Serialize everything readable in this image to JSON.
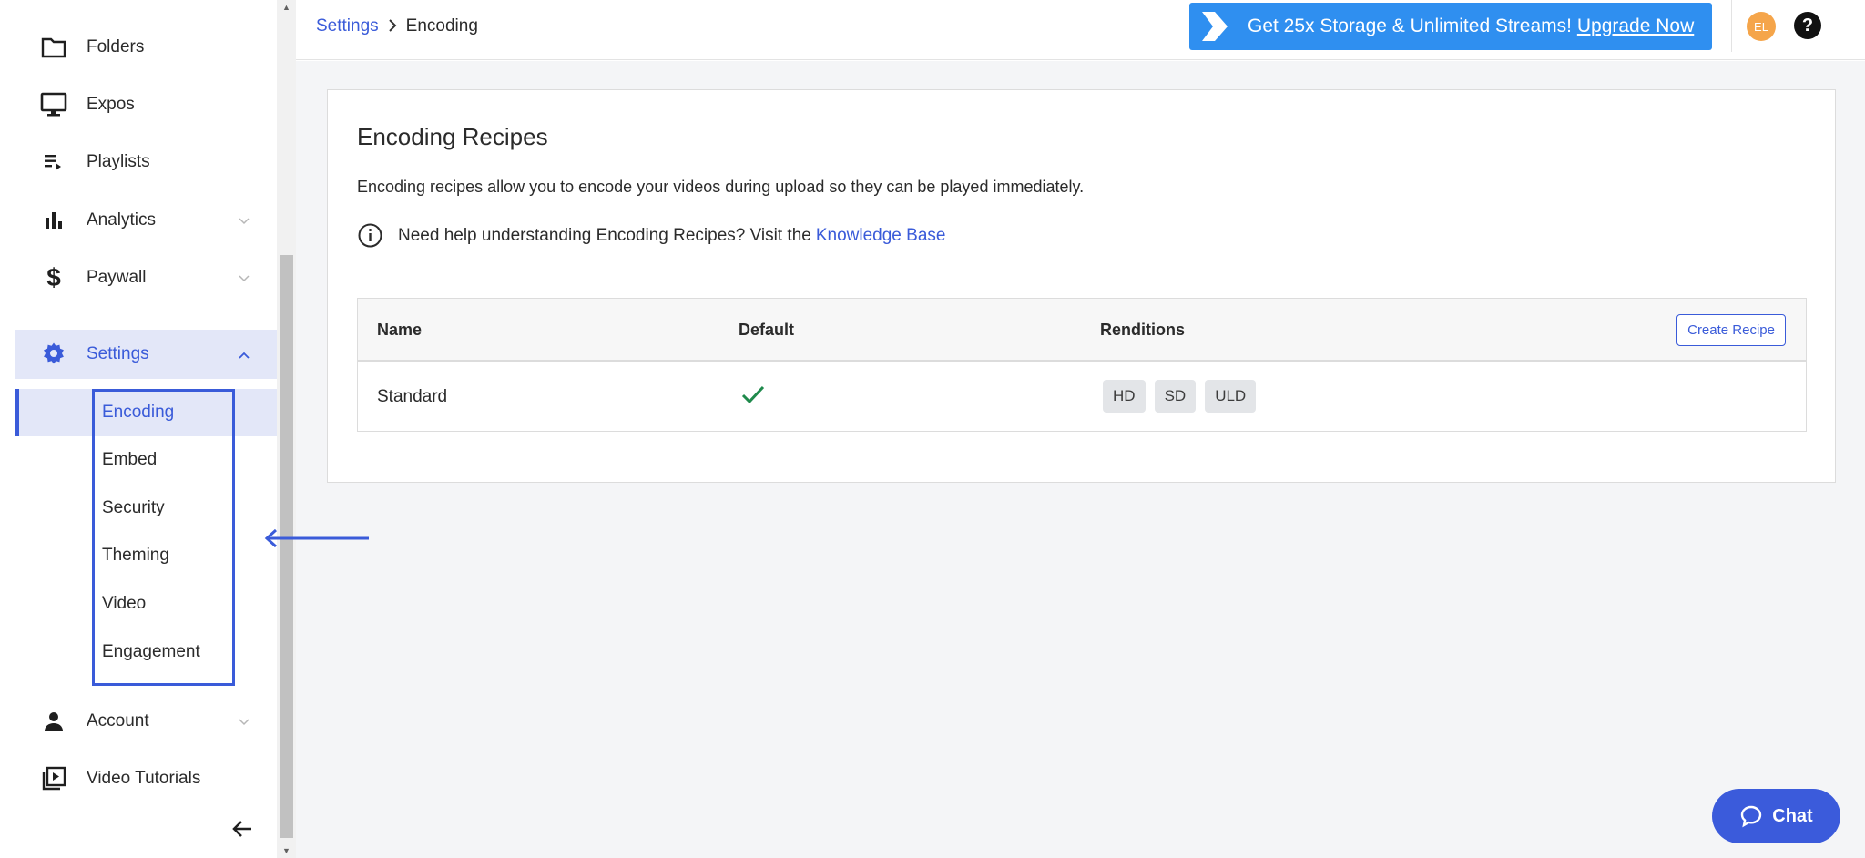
{
  "sidebar": {
    "items": [
      {
        "label": "Folders",
        "icon": "folder-icon"
      },
      {
        "label": "Expos",
        "icon": "monitor-icon"
      },
      {
        "label": "Playlists",
        "icon": "playlist-icon"
      },
      {
        "label": "Analytics",
        "icon": "bar-chart-icon"
      },
      {
        "label": "Paywall",
        "icon": "dollar-icon"
      },
      {
        "label": "Settings",
        "icon": "gear-icon"
      },
      {
        "label": "Account",
        "icon": "person-icon"
      },
      {
        "label": "Video Tutorials",
        "icon": "video-library-icon"
      }
    ],
    "settings_sub": [
      {
        "label": "Encoding"
      },
      {
        "label": "Embed"
      },
      {
        "label": "Security"
      },
      {
        "label": "Theming"
      },
      {
        "label": "Video"
      },
      {
        "label": "Engagement"
      }
    ]
  },
  "topbar": {
    "breadcrumb": {
      "parent": "Settings",
      "current": "Encoding"
    },
    "promo": {
      "text": "Get 25x Storage & Unlimited Streams!",
      "link": "Upgrade Now"
    },
    "avatar_initials": "EL",
    "help_glyph": "?"
  },
  "main": {
    "title": "Encoding Recipes",
    "description": "Encoding recipes allow you to encode your videos during upload so they can be played immediately.",
    "help_text": "Need help understanding Encoding Recipes? Visit the",
    "help_link": "Knowledge Base",
    "table": {
      "headers": {
        "name": "Name",
        "default": "Default",
        "renditions": "Renditions"
      },
      "create_button": "Create Recipe",
      "rows": [
        {
          "name": "Standard",
          "default": true,
          "renditions": [
            "HD",
            "SD",
            "ULD"
          ]
        }
      ]
    }
  },
  "chat": {
    "label": "Chat"
  },
  "colors": {
    "accent": "#3a5bd9",
    "promo": "#2f8ff0",
    "avatar": "#f5a54a",
    "check": "#1f8a4c"
  }
}
